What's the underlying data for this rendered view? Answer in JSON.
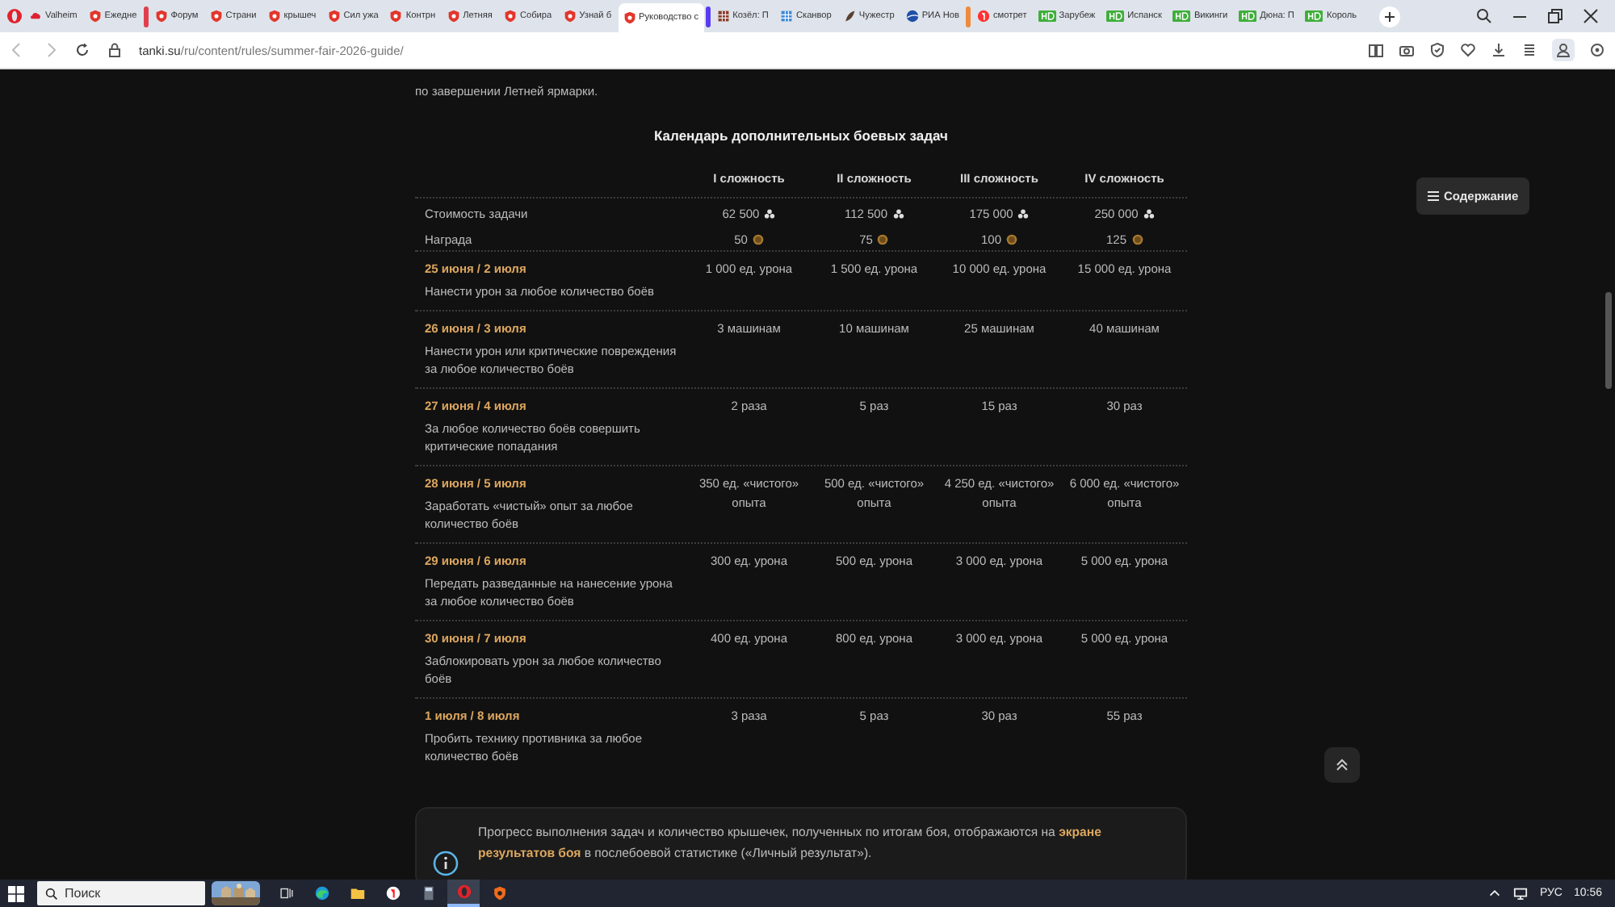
{
  "browser": {
    "tabs": [
      {
        "kind": "cloud",
        "label": "Valheim",
        "selected": false
      },
      {
        "kind": "shield",
        "label": "Ежедне",
        "selected": false
      },
      {
        "kind": "group",
        "color": "#e0404e"
      },
      {
        "kind": "shield",
        "label": "Форум",
        "selected": false
      },
      {
        "kind": "shield",
        "label": "Страни",
        "selected": false
      },
      {
        "kind": "shield",
        "label": "крышеч",
        "selected": false
      },
      {
        "kind": "shield",
        "label": "Сил ужа",
        "selected": false
      },
      {
        "kind": "shield",
        "label": "Контрн",
        "selected": false
      },
      {
        "kind": "shield",
        "label": "Летняя",
        "selected": false
      },
      {
        "kind": "shield",
        "label": "Собира",
        "selected": false
      },
      {
        "kind": "shield",
        "label": "Узнай б",
        "selected": false
      },
      {
        "kind": "shield",
        "label": "Руководство с",
        "selected": true
      },
      {
        "kind": "group",
        "color": "#5a3cf0"
      },
      {
        "kind": "grid",
        "label": "Козёл: П",
        "selected": false
      },
      {
        "kind": "grid-blue",
        "label": "Сканвор",
        "selected": false
      },
      {
        "kind": "feather",
        "label": "Чужестр",
        "selected": false
      },
      {
        "kind": "globe",
        "label": "РИА Нов",
        "selected": false
      },
      {
        "kind": "group",
        "color": "#f08a3c"
      },
      {
        "kind": "ya",
        "label": "смотрет",
        "selected": false
      },
      {
        "kind": "hd",
        "label": "Зарубеж",
        "selected": false
      },
      {
        "kind": "hd",
        "label": "Испанск",
        "selected": false
      },
      {
        "kind": "hd",
        "label": "Викинги",
        "selected": false
      },
      {
        "kind": "hd",
        "label": "Дюна: П",
        "selected": false
      },
      {
        "kind": "hd",
        "label": "Король",
        "selected": false
      }
    ],
    "url": {
      "host": "tanki.su",
      "path": "/ru/content/rules/summer-fair-2026-guide/"
    }
  },
  "page": {
    "intro": "по завершении Летней ярмарки.",
    "title": "Календарь дополнительных боевых задач",
    "table": {
      "columns": [
        "I сложность",
        "II сложность",
        "III сложность",
        "IV сложность"
      ],
      "price_rows": [
        {
          "kind": "cost",
          "label": "Стоимость задачи",
          "values": [
            "62 500",
            "112 500",
            "175 000",
            "250 000"
          ]
        },
        {
          "kind": "reward",
          "label": "Награда",
          "values": [
            "50",
            "75",
            "100",
            "125"
          ]
        }
      ],
      "tasks": [
        {
          "dates": "25 июня / 2 июля",
          "description": "Нанести урон за любое количество боёв",
          "values": [
            "1 000 ед. урона",
            "1 500 ед. урона",
            "10 000 ед. урона",
            "15 000 ед. урона"
          ]
        },
        {
          "dates": "26 июня / 3 июля",
          "description": "Нанести урон или критические повреждения за любое количество боёв",
          "values": [
            "3 машинам",
            "10 машинам",
            "25 машинам",
            "40 машинам"
          ]
        },
        {
          "dates": "27 июня / 4 июля",
          "description": "За любое количество боёв совершить критические попадания",
          "values": [
            "2 раза",
            "5 раз",
            "15 раз",
            "30 раз"
          ]
        },
        {
          "dates": "28 июня / 5 июля",
          "description": "Заработать «чистый» опыт за любое количество боёв",
          "values": [
            "350 ед. «чистого» опыта",
            "500 ед. «чистого» опыта",
            "4 250 ед. «чистого» опыта",
            "6 000 ед. «чистого» опыта"
          ]
        },
        {
          "dates": "29 июня / 6 июля",
          "description": "Передать разведанные на нанесение урона за любое количество боёв",
          "values": [
            "300 ед. урона",
            "500 ед. урона",
            "3 000 ед. урона",
            "5 000 ед. урона"
          ]
        },
        {
          "dates": "30 июня / 7 июля",
          "description": "Заблокировать урон за любое количество боёв",
          "values": [
            "400 ед. урона",
            "800 ед. урона",
            "3 000 ед. урона",
            "5 000 ед. урона"
          ]
        },
        {
          "dates": "1 июля / 8 июля",
          "description": "Пробить технику противника за любое количество боёв",
          "values": [
            "3 раза",
            "5 раз",
            "30 раз",
            "55 раз"
          ]
        }
      ]
    },
    "note": "Прогресс выполнения задач и количество крышечек, полученных по итогам боя, отображаются на **экране результатов боя** в послебоевой статистике («Личный результат»).",
    "toc_button": "Содержание"
  },
  "taskbar": {
    "search": {
      "placeholder": "Поиск"
    },
    "apps": [
      {
        "kind": "task-view",
        "selected": false
      },
      {
        "kind": "edge",
        "selected": false
      },
      {
        "kind": "folder",
        "selected": false
      },
      {
        "kind": "yandex",
        "selected": false
      },
      {
        "kind": "calculator",
        "selected": false
      },
      {
        "kind": "opera",
        "selected": true
      },
      {
        "kind": "tanki",
        "selected": false
      }
    ],
    "language": "РУС",
    "time": "10:56"
  }
}
